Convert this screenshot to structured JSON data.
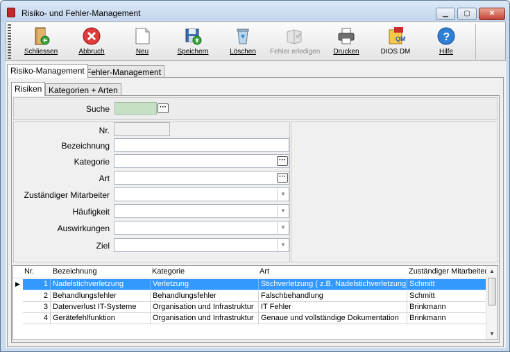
{
  "window": {
    "title": "Risiko- und Fehler-Management"
  },
  "toolbar": {
    "buttons": [
      {
        "label": "Schliessen",
        "icon": "door-exit-icon"
      },
      {
        "label": "Abbruch",
        "icon": "cancel-x-icon"
      },
      {
        "label": "Neu",
        "icon": "new-document-icon"
      },
      {
        "label": "Speichern",
        "icon": "save-disk-icon"
      },
      {
        "label": "Löschen",
        "icon": "recycle-bin-icon"
      },
      {
        "label": "Fehler erledigen",
        "icon": "done-book-icon",
        "disabled": true
      },
      {
        "label": "Drucken",
        "icon": "printer-icon"
      },
      {
        "label": "DIOS DM",
        "icon": "qm-pdf-icon"
      },
      {
        "label": "Hilfe",
        "icon": "help-question-icon"
      }
    ]
  },
  "main_tabs": [
    "Risiko-Management",
    "Fehler-Management"
  ],
  "sub_tabs": [
    "Risiken",
    "Kategorien + Arten"
  ],
  "search": {
    "label": "Suche",
    "value": ""
  },
  "form": {
    "nr_label": "Nr.",
    "bezeichnung_label": "Bezeichnung",
    "kategorie_label": "Kategorie",
    "art_label": "Art",
    "zustaendig_label": "Zuständiger Mitarbeiter",
    "haeufigkeit_label": "Häufigkeit",
    "auswirkungen_label": "Auswirkungen",
    "ziel_label": "Ziel"
  },
  "grid": {
    "columns": [
      "Nr.",
      "Bezeichnung",
      "Kategorie",
      "Art",
      "Zuständiger Mitarbeiter"
    ],
    "rows": [
      [
        "1",
        "Nadelstichverletzung",
        "Verletzung",
        "Stichverletzung ( z.B. Nadelstichverletzung)",
        "Schmitt"
      ],
      [
        "2",
        "Behandlungsfehler",
        "Behandlungsfehler",
        "Falschbehandlung",
        "Schmitt"
      ],
      [
        "3",
        "Datenverlust IT-Systeme",
        "Organisation und Infrastruktur",
        "IT Fehler",
        "Brinkmann"
      ],
      [
        "4",
        "Gerätefehlfunktion",
        "Organisation und Infrastruktur",
        "Genaue und vollständige Dokumentation",
        "Brinkmann"
      ]
    ],
    "selected_row": 0
  },
  "colors": {
    "selection": "#3399ff",
    "search_field": "#c6e0c6"
  }
}
